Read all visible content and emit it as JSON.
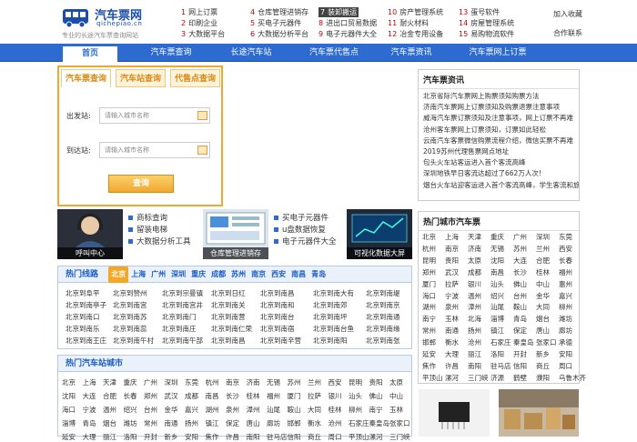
{
  "logo": {
    "title": "汽车票网",
    "domain": "qichepiao.cn",
    "tagline": "专业的长途汽车票查询网站"
  },
  "quick_links": [
    {
      "n": "1",
      "text": "网上订票"
    },
    {
      "n": "2",
      "text": "印刷企业"
    },
    {
      "n": "3",
      "text": "大数据平台"
    },
    {
      "n": "4",
      "text": "仓库管理进销存"
    },
    {
      "n": "5",
      "text": "买电子元器件"
    },
    {
      "n": "6",
      "text": "大数据分析平台"
    },
    {
      "n": "7",
      "text": "装卸搬运"
    },
    {
      "n": "8",
      "text": "进出口贸易数据"
    },
    {
      "n": "9",
      "text": "电子元器件大全"
    },
    {
      "n": "10",
      "text": "房产管理系统"
    },
    {
      "n": "11",
      "text": "耐火材料"
    },
    {
      "n": "12",
      "text": "冶金专用设备"
    },
    {
      "n": "13",
      "text": "蛋号软件"
    },
    {
      "n": "14",
      "text": "房屋管理系统"
    },
    {
      "n": "15",
      "text": "易购物流软件"
    }
  ],
  "top_right": {
    "favorite": "加入收藏",
    "cooperate": "合作联系"
  },
  "nav": [
    "首页",
    "汽车票查询",
    "长途汽车站",
    "汽车票代售点",
    "汽车票资讯",
    "汽车票网上订票"
  ],
  "search": {
    "tabs": [
      "汽车票查询",
      "汽车站查询",
      "代售点查询"
    ],
    "from_label": "出发站:",
    "to_label": "到达站:",
    "from_placeholder": "请输入城市名称",
    "to_placeholder": "请输入城市名称",
    "button": "查询"
  },
  "promo": {
    "caption1": "呼叫中心",
    "list1": [
      "商标查询",
      "留装电梯",
      "大数据分析工具"
    ],
    "caption2": "仓库管理进销存",
    "list2": [
      "买电子元器件",
      "u盘数据恢复",
      "电子元器件大全"
    ],
    "caption3": "可视化数据大屏"
  },
  "hot_lines": {
    "title": "热门线路",
    "cities": [
      "北京",
      "上海",
      "广州",
      "深圳",
      "重庆",
      "成都",
      "苏州",
      "南京",
      "西安",
      "南昌",
      "青岛"
    ],
    "routes": [
      [
        "北京到阜平",
        "北京到赞州",
        "北京到宗曼镇",
        "北京到日红",
        "北京到南昌",
        "北京到南大有",
        "北京到南堤"
      ],
      [
        "北京到南亭子",
        "北京到南宫",
        "北京到南宫井",
        "北京到南关",
        "北京到南和",
        "北京到南郊",
        "北京到南京"
      ],
      [
        "北京到南口",
        "北京到南苏",
        "北京到南门",
        "北京到南营",
        "北京到南台",
        "北京到南坪",
        "北京到南通"
      ],
      [
        "北京到南乐",
        "北京到南蕊",
        "北京到南庄",
        "北京到南仁荣",
        "北京到南宿",
        "北京到南台鱼",
        "北京到南缘"
      ],
      [
        "北京到南王庄",
        "北京到南午村",
        "北京到南午部",
        "北京到南昌",
        "北京到南辛营",
        "北京到南阳",
        "北京到南张"
      ]
    ]
  },
  "stations": {
    "title": "热门汽车站城市",
    "rows": [
      [
        "北京",
        "上海",
        "天津",
        "重庆",
        "广州",
        "深圳",
        "东莞",
        "杭州",
        "南京",
        "济南",
        "无锡",
        "苏州",
        "兰州",
        "西安",
        "昆明",
        "贵阳",
        "太原"
      ],
      [
        "沈阳",
        "大连",
        "合肥",
        "长春",
        "郑州",
        "武汉",
        "成都",
        "南昌",
        "长沙",
        "桂林",
        "福州",
        "厦门",
        "拉萨",
        "银川",
        "汕头",
        "佛山",
        "中山",
        "惠州"
      ],
      [
        "海口",
        "宁波",
        "温州",
        "绍兴",
        "台州",
        "金华",
        "嘉兴",
        "湖州",
        "泉州",
        "漳州",
        "汕尾",
        "鞍山",
        "大同",
        "桂林",
        "柳州",
        "南宁",
        "玉林",
        "北海"
      ],
      [
        "淄博",
        "青岛",
        "烟台",
        "潍坊",
        "常州",
        "南通",
        "扬州",
        "镇江",
        "保定",
        "唐山",
        "廊坊",
        "邯郸",
        "衡水",
        "沧州",
        "石家庄",
        "秦皇岛",
        "张家口",
        "承德"
      ],
      [
        "延安",
        "大理",
        "丽江",
        "洛阳",
        "开封",
        "新乡",
        "安阳",
        "焦作",
        "许昌",
        "南阳",
        "驻马店",
        "信阳",
        "商丘",
        "周口",
        "平顶山",
        "漯河",
        "三门峡",
        "济源"
      ]
    ]
  },
  "news": {
    "title": "汽车票资讯",
    "items": [
      "北京省际汽车票网上购票须知购票方法",
      "济南汽车票网上订票须知及购票退票注意事项",
      "威海汽车票订票须知及注意事项，网上订票不再难",
      "沧州客车票网上订票须知，订票如此轻松",
      "云南汽车客票微信购票流程介绍，微信买票不再难",
      "2019苏州代理售票网点地址",
      "包头火车站客运进入首个客流高峰",
      "深圳地铁早日客流达超过了662万人次!",
      "烟台火车站迎客运进入首个客流高峰，学生客流和旅游客"
    ]
  },
  "hot_cities": {
    "title": "热门城市汽车票",
    "rows": [
      [
        "北京",
        "上海",
        "天津",
        "重庆",
        "广州",
        "深圳",
        "东莞"
      ],
      [
        "杭州",
        "南京",
        "济南",
        "无锡",
        "苏州",
        "兰州",
        "西安"
      ],
      [
        "昆明",
        "贵阳",
        "太原",
        "沈阳",
        "大连",
        "合肥",
        "长春"
      ],
      [
        "郑州",
        "武汉",
        "成都",
        "南昌",
        "长沙",
        "桂林",
        "福州"
      ],
      [
        "厦门",
        "拉萨",
        "银川",
        "汕头",
        "佛山",
        "中山",
        "惠州"
      ],
      [
        "海口",
        "宁波",
        "温州",
        "绍兴",
        "台州",
        "金华",
        "嘉兴"
      ],
      [
        "湖州",
        "泉州",
        "漳州",
        "汕尾",
        "鞍山",
        "大同",
        "柳州"
      ],
      [
        "南宁",
        "玉林",
        "北海",
        "淄博",
        "青岛",
        "烟台",
        "潍坊"
      ],
      [
        "常州",
        "南通",
        "扬州",
        "镇江",
        "保定",
        "唐山",
        "廊坊"
      ],
      [
        "邯郸",
        "衡水",
        "沧州",
        "石家庄",
        "秦皇岛",
        "张家口",
        "承德"
      ],
      [
        "延安",
        "大理",
        "丽江",
        "洛阳",
        "开封",
        "新乡",
        "安阳"
      ],
      [
        "焦作",
        "许昌",
        "南阳",
        "驻马店",
        "信阳",
        "商丘",
        "周口"
      ],
      [
        "平顶山",
        "漯河",
        "三门峡",
        "济源",
        "鹤壁",
        "濮阳",
        "乌鲁木齐"
      ]
    ]
  }
}
